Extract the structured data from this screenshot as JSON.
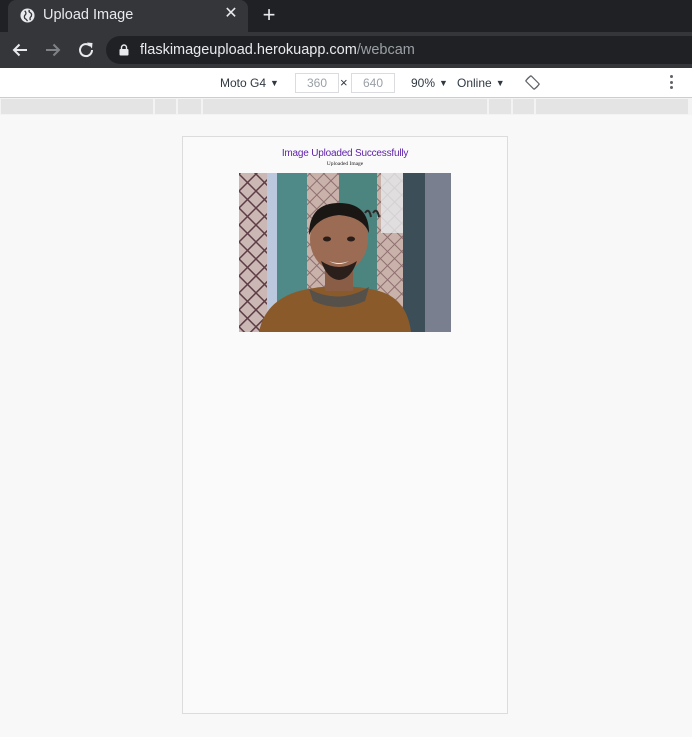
{
  "browser": {
    "tab_title": "Upload Image",
    "url_host": "flaskimageupload.herokuapp.com",
    "url_path": "/webcam"
  },
  "device_toolbar": {
    "device": "Moto G4",
    "width": "360",
    "height": "640",
    "separator": "×",
    "zoom": "90%",
    "throttling": "Online"
  },
  "page": {
    "heading": "Image Uploaded Successfully",
    "subheading": "Uploaded Image",
    "accent_color": "#5b1fa8"
  },
  "icons": {
    "tab": "globe-icon",
    "close": "close-icon",
    "new_tab": "plus-icon",
    "back": "back-arrow-icon",
    "forward": "forward-arrow-icon",
    "reload": "reload-icon",
    "lock": "lock-icon",
    "rotate": "rotate-icon",
    "menu": "more-vert-icon"
  }
}
